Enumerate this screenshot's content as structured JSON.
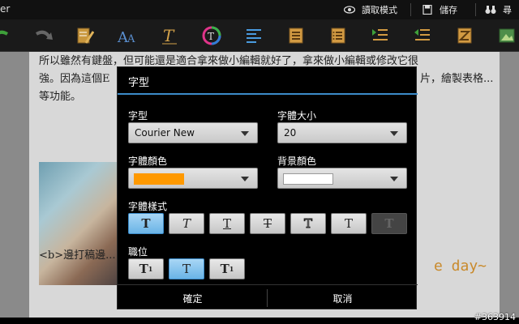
{
  "actionbar": {
    "app_title": "er",
    "reading_mode": "讀取模式",
    "save": "儲存",
    "find": "尋"
  },
  "document": {
    "line1": "所以雖然有鍵盤，但可能還是適合拿來做小編輯就好了，拿來做小編輯或修改它很",
    "line2_left": "強。因為這個E",
    "line2_right": "片，繪製表格...",
    "line3": "等功能。",
    "day_text": "e day~",
    "bottom_text": "<b>邊打稿邊...",
    "watermark": "#363914"
  },
  "dialog": {
    "title": "字型",
    "font_label": "字型",
    "font_value": "Courier New",
    "size_label": "字體大小",
    "size_value": "20",
    "font_color_label": "字體顏色",
    "font_color": "#ff9900",
    "bg_color_label": "背景顏色",
    "bg_color": "#ffffff",
    "style_label": "字體樣式",
    "style_buttons": [
      "T",
      "T",
      "T",
      "T",
      "T",
      "T",
      "T"
    ],
    "align_label": "職位",
    "align_buttons": [
      "T",
      "T",
      "T"
    ],
    "ok": "確定",
    "cancel": "取消"
  },
  "colors": {
    "accent": "#3b8bc9",
    "selected_button": "#6ab4e6"
  }
}
